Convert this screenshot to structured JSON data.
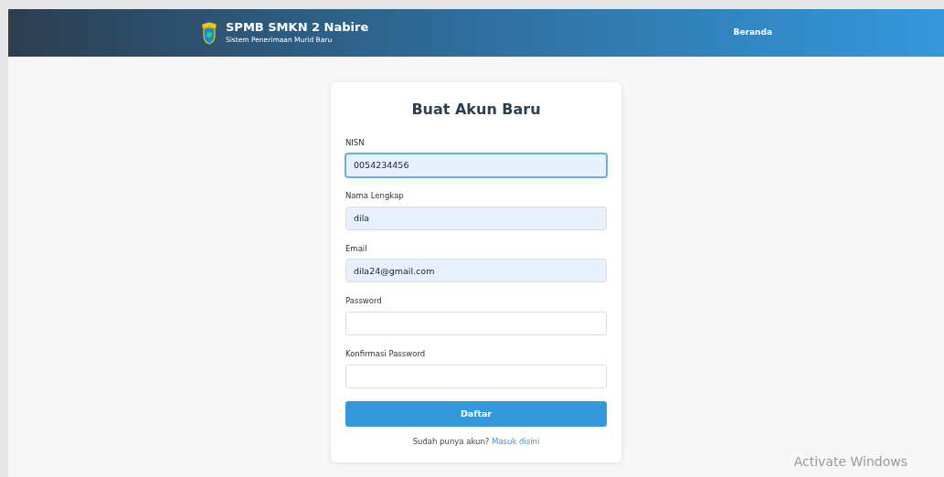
{
  "navbar": {
    "title": "SPMB SMKN 2 Nabire",
    "subtitle": "Sistem Penerimaan Murid Baru",
    "links": [
      {
        "label": "Beranda"
      }
    ]
  },
  "form": {
    "title": "Buat Akun Baru",
    "fields": [
      {
        "label": "NISN",
        "value": "0054234456",
        "focused": true,
        "autofilled": true
      },
      {
        "label": "Nama Lengkap",
        "value": "dila",
        "focused": false,
        "autofilled": true
      },
      {
        "label": "Email",
        "value": "dila24@gmail.com",
        "focused": false,
        "autofilled": true
      },
      {
        "label": "Password",
        "focused": false,
        "autofilled": false
      },
      {
        "label": "Konfirmasi Password",
        "focused": false,
        "autofilled": false
      }
    ],
    "submit": "Daftar",
    "footer_text": "Sudah punya akun?",
    "footer_link": "Masuk disini"
  },
  "os_overlay": {
    "text": "Activate Windows"
  }
}
